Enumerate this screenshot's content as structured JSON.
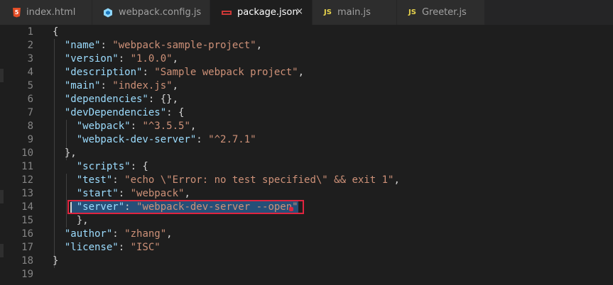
{
  "tabs": [
    {
      "label": "index.html",
      "icon": "html5-icon",
      "active": false
    },
    {
      "label": "webpack.config.js",
      "icon": "webpack-icon",
      "active": false
    },
    {
      "label": "package.json",
      "icon": "npm-icon",
      "active": true,
      "close": "×"
    },
    {
      "label": "main.js",
      "icon": "javascript-icon",
      "active": false
    },
    {
      "label": "Greeter.js",
      "icon": "javascript-icon",
      "active": false
    }
  ],
  "icons": {
    "js_text": "JS",
    "html5_text": "5"
  },
  "colors": {
    "background": "#1e1e1e",
    "key": "#9cdcfe",
    "string": "#ce9178",
    "punctuation": "#d4d4d4",
    "line_number": "#858585",
    "selection": "#264f78",
    "highlight_box": "#e0243f"
  },
  "editor": {
    "lines": [
      {
        "n": "1",
        "segs": [
          [
            "p",
            "{"
          ]
        ]
      },
      {
        "n": "2",
        "segs": [
          [
            "p",
            "  "
          ],
          [
            "k",
            "\"name\""
          ],
          [
            "p",
            ": "
          ],
          [
            "s",
            "\"webpack-sample-project\""
          ],
          [
            "p",
            ","
          ]
        ]
      },
      {
        "n": "3",
        "segs": [
          [
            "p",
            "  "
          ],
          [
            "k",
            "\"version\""
          ],
          [
            "p",
            ": "
          ],
          [
            "s",
            "\"1.0.0\""
          ],
          [
            "p",
            ","
          ]
        ]
      },
      {
        "n": "4",
        "segs": [
          [
            "p",
            "  "
          ],
          [
            "k",
            "\"description\""
          ],
          [
            "p",
            ": "
          ],
          [
            "s",
            "\"Sample webpack project\""
          ],
          [
            "p",
            ","
          ]
        ]
      },
      {
        "n": "5",
        "segs": [
          [
            "p",
            "  "
          ],
          [
            "k",
            "\"main\""
          ],
          [
            "p",
            ": "
          ],
          [
            "s",
            "\"index.js\""
          ],
          [
            "p",
            ","
          ]
        ]
      },
      {
        "n": "6",
        "segs": [
          [
            "p",
            "  "
          ],
          [
            "k",
            "\"dependencies\""
          ],
          [
            "p",
            ": {},"
          ]
        ]
      },
      {
        "n": "7",
        "segs": [
          [
            "p",
            "  "
          ],
          [
            "k",
            "\"devDependencies\""
          ],
          [
            "p",
            ": {"
          ]
        ]
      },
      {
        "n": "8",
        "segs": [
          [
            "p",
            "    "
          ],
          [
            "k",
            "\"webpack\""
          ],
          [
            "p",
            ": "
          ],
          [
            "s",
            "\"^3.5.5\""
          ],
          [
            "p",
            ","
          ]
        ]
      },
      {
        "n": "9",
        "segs": [
          [
            "p",
            "    "
          ],
          [
            "k",
            "\"webpack-dev-server\""
          ],
          [
            "p",
            ": "
          ],
          [
            "s",
            "\"^2.7.1\""
          ]
        ]
      },
      {
        "n": "10",
        "segs": [
          [
            "p",
            "  },"
          ]
        ]
      },
      {
        "n": "11",
        "segs": [
          [
            "p",
            "    "
          ],
          [
            "k",
            "\"scripts\""
          ],
          [
            "p",
            ": {"
          ]
        ]
      },
      {
        "n": "12",
        "segs": [
          [
            "p",
            "    "
          ],
          [
            "k",
            "\"test\""
          ],
          [
            "p",
            ": "
          ],
          [
            "s",
            "\"echo \\\"Error: no test specified\\\" && exit 1\""
          ],
          [
            "p",
            ","
          ]
        ]
      },
      {
        "n": "13",
        "segs": [
          [
            "p",
            "    "
          ],
          [
            "k",
            "\"start\""
          ],
          [
            "p",
            ": "
          ],
          [
            "s",
            "\"webpack\""
          ],
          [
            "p",
            ","
          ]
        ]
      },
      {
        "n": "14",
        "segs": [
          [
            "p",
            "    "
          ],
          [
            "k",
            "\"server\""
          ],
          [
            "p",
            ": "
          ],
          [
            "s",
            "\"webpack-dev-server --open\""
          ]
        ]
      },
      {
        "n": "15",
        "segs": [
          [
            "p",
            "    },"
          ]
        ]
      },
      {
        "n": "16",
        "segs": [
          [
            "p",
            "  "
          ],
          [
            "k",
            "\"author\""
          ],
          [
            "p",
            ": "
          ],
          [
            "s",
            "\"zhang\""
          ],
          [
            "p",
            ","
          ]
        ]
      },
      {
        "n": "17",
        "segs": [
          [
            "p",
            "  "
          ],
          [
            "k",
            "\"license\""
          ],
          [
            "p",
            ": "
          ],
          [
            "s",
            "\"ISC\""
          ]
        ]
      },
      {
        "n": "18",
        "segs": [
          [
            "p",
            "}"
          ]
        ]
      },
      {
        "n": "19",
        "segs": []
      }
    ]
  }
}
